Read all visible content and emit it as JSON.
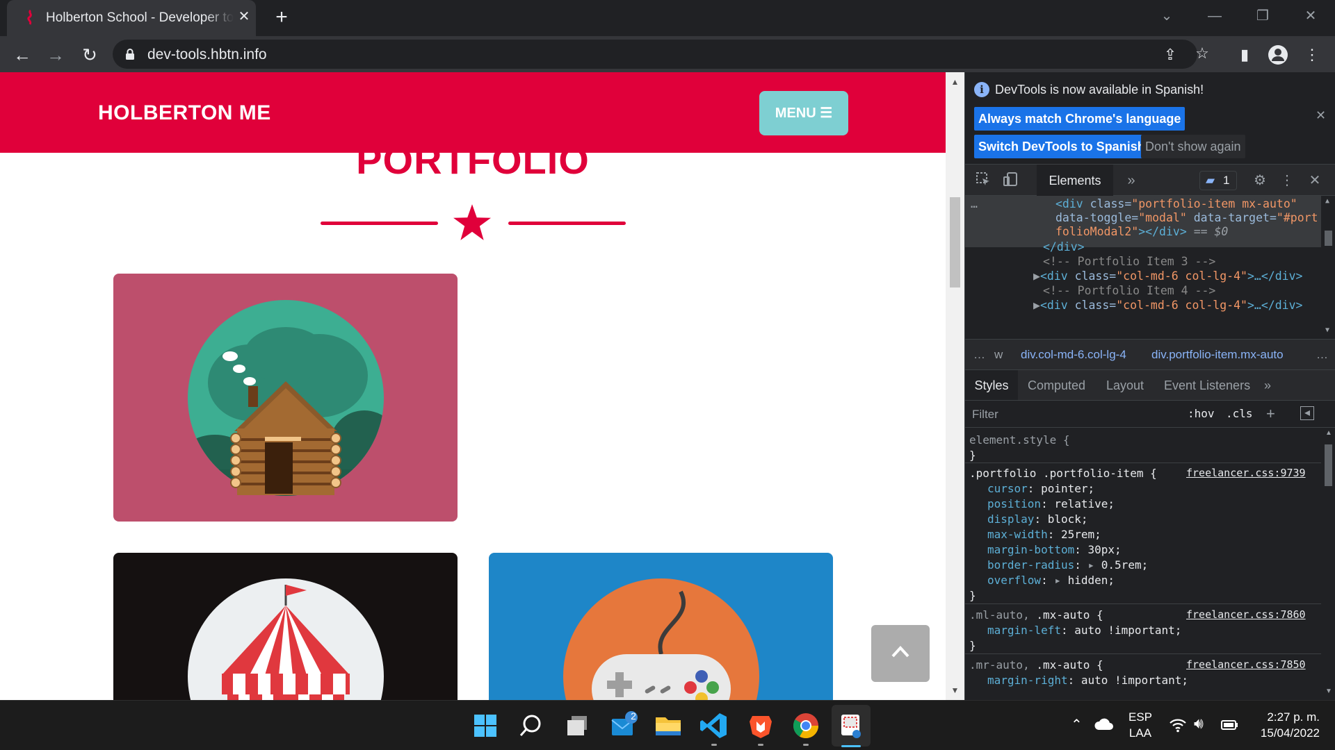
{
  "browser": {
    "tab_title": "Holberton School - Developer tools",
    "url": "dev-tools.hbtn.info"
  },
  "page": {
    "brand": "HOLBERTON ME",
    "menu_label": "MENU",
    "section_heading": "PORTFOLIO",
    "colors": {
      "primary": "#e0003a",
      "menu_button": "#7ecfd2"
    },
    "portfolio_items": [
      {
        "name": "cabin",
        "background": "#bd4f6c"
      },
      {
        "name": "circus",
        "background": "#151111"
      },
      {
        "name": "game",
        "background": "#1e86c8"
      }
    ]
  },
  "devtools": {
    "notice": "DevTools is now available in Spanish!",
    "btn_match": "Always match Chrome's language",
    "btn_switch": "Switch DevTools to Spanish",
    "btn_dont": "Don't show again",
    "tab_elements": "Elements",
    "issues_count": "1",
    "dom": {
      "l1": [
        "<div ",
        "class=",
        "\"portfolio-item mx-auto\""
      ],
      "l2": [
        "data-toggle=",
        "\"modal\"",
        " data-target=",
        "\"#port"
      ],
      "l3a": "folioModal2\"",
      "l3b": "></div>",
      "l3c": " == $0",
      "l4": "</div>",
      "l5": "<!-- Portfolio Item 3 -->",
      "l6": [
        "<div ",
        "class=",
        "\"col-md-6 col-lg-4\"",
        ">…</div>"
      ],
      "l7": "<!-- Portfolio Item 4 -->",
      "l8": [
        "<div ",
        "class=",
        "\"col-md-6 col-lg-4\"",
        ">…</div>"
      ]
    },
    "breadcrumbs": {
      "partial": "w",
      "crumb1": "div.col-md-6.col-lg-4",
      "crumb2": "div.portfolio-item.mx-auto"
    },
    "subtabs": [
      "Styles",
      "Computed",
      "Layout",
      "Event Listeners"
    ],
    "filter_placeholder": "Filter",
    "hov": ":hov",
    "cls": ".cls",
    "styles": {
      "element_style": "element.style {",
      "close": "}",
      "rule1_selector": ".portfolio .portfolio-item {",
      "rule1_source": "freelancer.css:9739",
      "rule1_props": [
        [
          "cursor",
          "pointer;"
        ],
        [
          "position",
          "relative;"
        ],
        [
          "display",
          "block;"
        ],
        [
          "max-width",
          "25rem;"
        ],
        [
          "margin-bottom",
          "30px;"
        ],
        [
          "border-radius",
          "0.5rem;"
        ],
        [
          "overflow",
          "hidden;"
        ]
      ],
      "rule2_selector_dim": ".ml-auto,",
      "rule2_selector": " .mx-auto {",
      "rule2_source": "freelancer.css:7860",
      "rule2_prop": [
        "margin-left",
        "auto !important;"
      ],
      "rule3_selector_dim": ".mr-auto,",
      "rule3_selector": " .mx-auto {",
      "rule3_source": "freelancer.css:7850",
      "rule3_prop": [
        "margin-right",
        "auto !important;"
      ]
    }
  },
  "taskbar": {
    "lang1": "ESP",
    "lang2": "LAA",
    "time": "2:27 p. m.",
    "date": "15/04/2022",
    "mail_badge": "2"
  }
}
